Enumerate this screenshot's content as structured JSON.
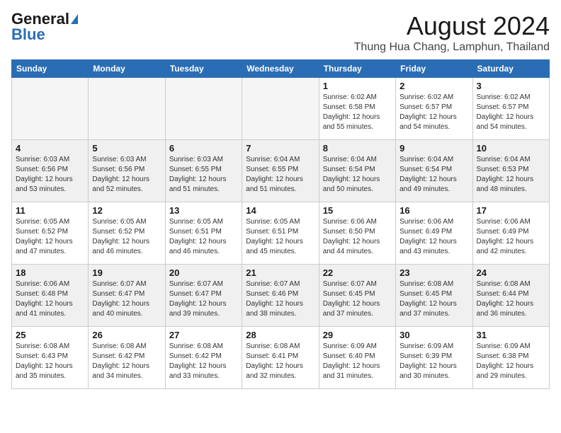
{
  "header": {
    "logo_general": "General",
    "logo_blue": "Blue",
    "month_year": "August 2024",
    "location": "Thung Hua Chang, Lamphun, Thailand"
  },
  "days_of_week": [
    "Sunday",
    "Monday",
    "Tuesday",
    "Wednesday",
    "Thursday",
    "Friday",
    "Saturday"
  ],
  "weeks": [
    [
      {
        "day": "",
        "empty": true
      },
      {
        "day": "",
        "empty": true
      },
      {
        "day": "",
        "empty": true
      },
      {
        "day": "",
        "empty": true
      },
      {
        "day": "1",
        "sunrise": "6:02 AM",
        "sunset": "6:58 PM",
        "daylight": "12 hours and 55 minutes."
      },
      {
        "day": "2",
        "sunrise": "6:02 AM",
        "sunset": "6:57 PM",
        "daylight": "12 hours and 54 minutes."
      },
      {
        "day": "3",
        "sunrise": "6:02 AM",
        "sunset": "6:57 PM",
        "daylight": "12 hours and 54 minutes."
      }
    ],
    [
      {
        "day": "4",
        "sunrise": "6:03 AM",
        "sunset": "6:56 PM",
        "daylight": "12 hours and 53 minutes."
      },
      {
        "day": "5",
        "sunrise": "6:03 AM",
        "sunset": "6:56 PM",
        "daylight": "12 hours and 52 minutes."
      },
      {
        "day": "6",
        "sunrise": "6:03 AM",
        "sunset": "6:55 PM",
        "daylight": "12 hours and 51 minutes."
      },
      {
        "day": "7",
        "sunrise": "6:04 AM",
        "sunset": "6:55 PM",
        "daylight": "12 hours and 51 minutes."
      },
      {
        "day": "8",
        "sunrise": "6:04 AM",
        "sunset": "6:54 PM",
        "daylight": "12 hours and 50 minutes."
      },
      {
        "day": "9",
        "sunrise": "6:04 AM",
        "sunset": "6:54 PM",
        "daylight": "12 hours and 49 minutes."
      },
      {
        "day": "10",
        "sunrise": "6:04 AM",
        "sunset": "6:53 PM",
        "daylight": "12 hours and 48 minutes."
      }
    ],
    [
      {
        "day": "11",
        "sunrise": "6:05 AM",
        "sunset": "6:52 PM",
        "daylight": "12 hours and 47 minutes."
      },
      {
        "day": "12",
        "sunrise": "6:05 AM",
        "sunset": "6:52 PM",
        "daylight": "12 hours and 46 minutes."
      },
      {
        "day": "13",
        "sunrise": "6:05 AM",
        "sunset": "6:51 PM",
        "daylight": "12 hours and 46 minutes."
      },
      {
        "day": "14",
        "sunrise": "6:05 AM",
        "sunset": "6:51 PM",
        "daylight": "12 hours and 45 minutes."
      },
      {
        "day": "15",
        "sunrise": "6:06 AM",
        "sunset": "6:50 PM",
        "daylight": "12 hours and 44 minutes."
      },
      {
        "day": "16",
        "sunrise": "6:06 AM",
        "sunset": "6:49 PM",
        "daylight": "12 hours and 43 minutes."
      },
      {
        "day": "17",
        "sunrise": "6:06 AM",
        "sunset": "6:49 PM",
        "daylight": "12 hours and 42 minutes."
      }
    ],
    [
      {
        "day": "18",
        "sunrise": "6:06 AM",
        "sunset": "6:48 PM",
        "daylight": "12 hours and 41 minutes."
      },
      {
        "day": "19",
        "sunrise": "6:07 AM",
        "sunset": "6:47 PM",
        "daylight": "12 hours and 40 minutes."
      },
      {
        "day": "20",
        "sunrise": "6:07 AM",
        "sunset": "6:47 PM",
        "daylight": "12 hours and 39 minutes."
      },
      {
        "day": "21",
        "sunrise": "6:07 AM",
        "sunset": "6:46 PM",
        "daylight": "12 hours and 38 minutes."
      },
      {
        "day": "22",
        "sunrise": "6:07 AM",
        "sunset": "6:45 PM",
        "daylight": "12 hours and 37 minutes."
      },
      {
        "day": "23",
        "sunrise": "6:08 AM",
        "sunset": "6:45 PM",
        "daylight": "12 hours and 37 minutes."
      },
      {
        "day": "24",
        "sunrise": "6:08 AM",
        "sunset": "6:44 PM",
        "daylight": "12 hours and 36 minutes."
      }
    ],
    [
      {
        "day": "25",
        "sunrise": "6:08 AM",
        "sunset": "6:43 PM",
        "daylight": "12 hours and 35 minutes."
      },
      {
        "day": "26",
        "sunrise": "6:08 AM",
        "sunset": "6:42 PM",
        "daylight": "12 hours and 34 minutes."
      },
      {
        "day": "27",
        "sunrise": "6:08 AM",
        "sunset": "6:42 PM",
        "daylight": "12 hours and 33 minutes."
      },
      {
        "day": "28",
        "sunrise": "6:08 AM",
        "sunset": "6:41 PM",
        "daylight": "12 hours and 32 minutes."
      },
      {
        "day": "29",
        "sunrise": "6:09 AM",
        "sunset": "6:40 PM",
        "daylight": "12 hours and 31 minutes."
      },
      {
        "day": "30",
        "sunrise": "6:09 AM",
        "sunset": "6:39 PM",
        "daylight": "12 hours and 30 minutes."
      },
      {
        "day": "31",
        "sunrise": "6:09 AM",
        "sunset": "6:38 PM",
        "daylight": "12 hours and 29 minutes."
      }
    ]
  ]
}
